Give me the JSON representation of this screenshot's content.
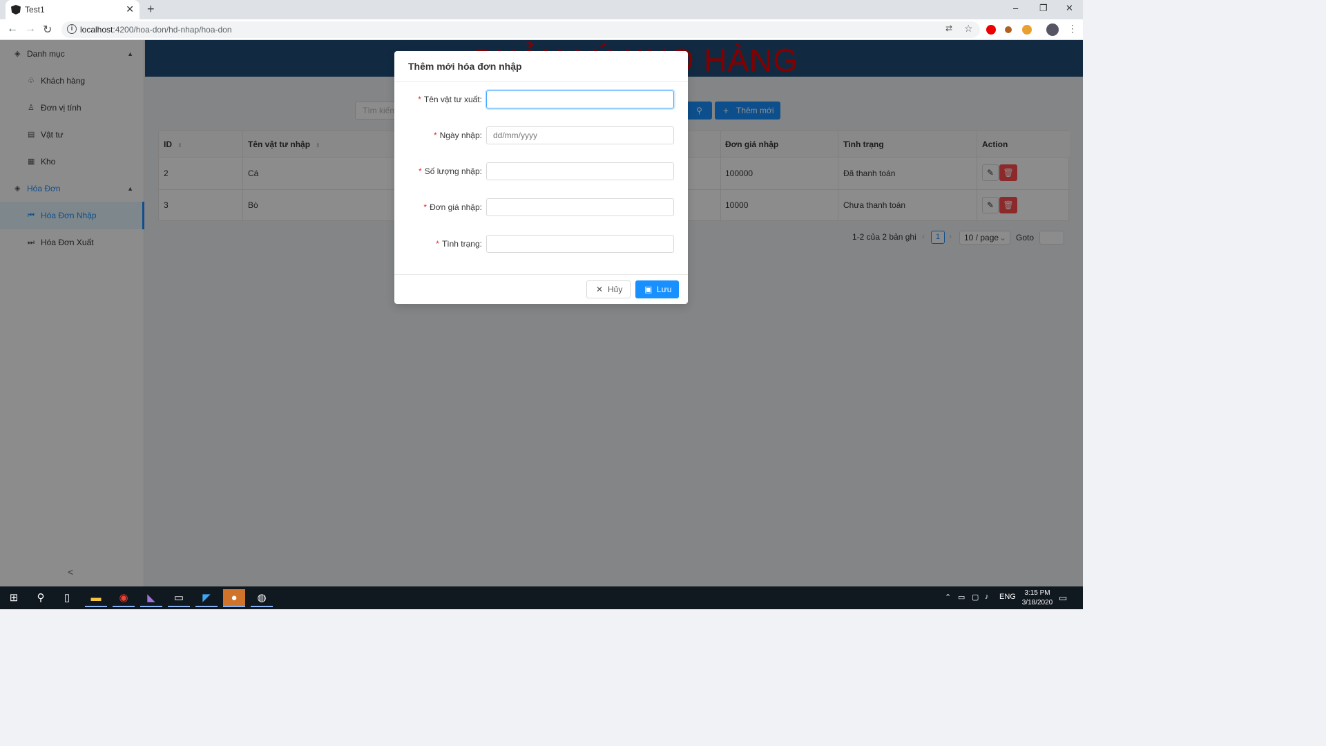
{
  "browser": {
    "tab_title": "Test1",
    "url_host": "localhost",
    "url_path": ":4200/hoa-don/hd-nhap/hoa-don",
    "new_tab": "+",
    "close_tab": "✕",
    "win_minimize": "–",
    "win_restore": "❐",
    "win_close": "✕"
  },
  "app": {
    "title": "QUẢN LÝ KHO HÀNG"
  },
  "sidebar": {
    "groups": [
      {
        "label": "Danh mục",
        "icon": "gem-icon"
      },
      {
        "label": "Hóa Đơn",
        "icon": "gem-icon"
      }
    ],
    "items": [
      {
        "label": "Khách hàng",
        "icon": "customer-icon"
      },
      {
        "label": "Đơn vị tính",
        "icon": "unit-icon"
      },
      {
        "label": "Vật tư",
        "icon": "material-icon"
      },
      {
        "label": "Kho",
        "icon": "warehouse-icon"
      },
      {
        "label": "Hóa Đơn Nhập",
        "icon": "step-backward-icon"
      },
      {
        "label": "Hóa Đơn Xuất",
        "icon": "step-forward-icon"
      }
    ],
    "collapse": "<"
  },
  "toolbar": {
    "search_placeholder": "Tìm kiếm",
    "add_label": "Thêm mới"
  },
  "table": {
    "columns": [
      "ID",
      "Tên vật tư nhập",
      "Đơn giá nhập",
      "Tình trạng",
      "Action"
    ],
    "rows": [
      {
        "id": "2",
        "name": "Cá",
        "price": "100000",
        "status": "Đã thanh toán"
      },
      {
        "id": "3",
        "name": "Bò",
        "price": "10000",
        "status": "Chưa thanh toán"
      }
    ]
  },
  "pagination": {
    "total": "1-2 của 2 bản ghi",
    "current_page": "1",
    "page_size": "10 / page",
    "goto_label": "Goto"
  },
  "modal": {
    "title": "Thêm mới hóa đơn nhập",
    "fields": [
      {
        "label": "Tên vật tư xuất",
        "value": "",
        "placeholder": ""
      },
      {
        "label": "Ngày nhập",
        "value": "",
        "placeholder": "dd/mm/yyyy"
      },
      {
        "label": "Số lượng nhập",
        "value": "",
        "placeholder": ""
      },
      {
        "label": "Đơn giá nhập",
        "value": "",
        "placeholder": ""
      },
      {
        "label": "Tình trạng",
        "value": "",
        "placeholder": ""
      }
    ],
    "cancel_label": "Hủy",
    "save_label": "Lưu"
  },
  "taskbar": {
    "lang": "ENG",
    "time": "3:15 PM",
    "date": "3/18/2020"
  },
  "colors": {
    "primary": "#1890ff",
    "danger": "#ff4d4f",
    "header_bg": "#1f4e79",
    "title_red": "#e00000"
  }
}
